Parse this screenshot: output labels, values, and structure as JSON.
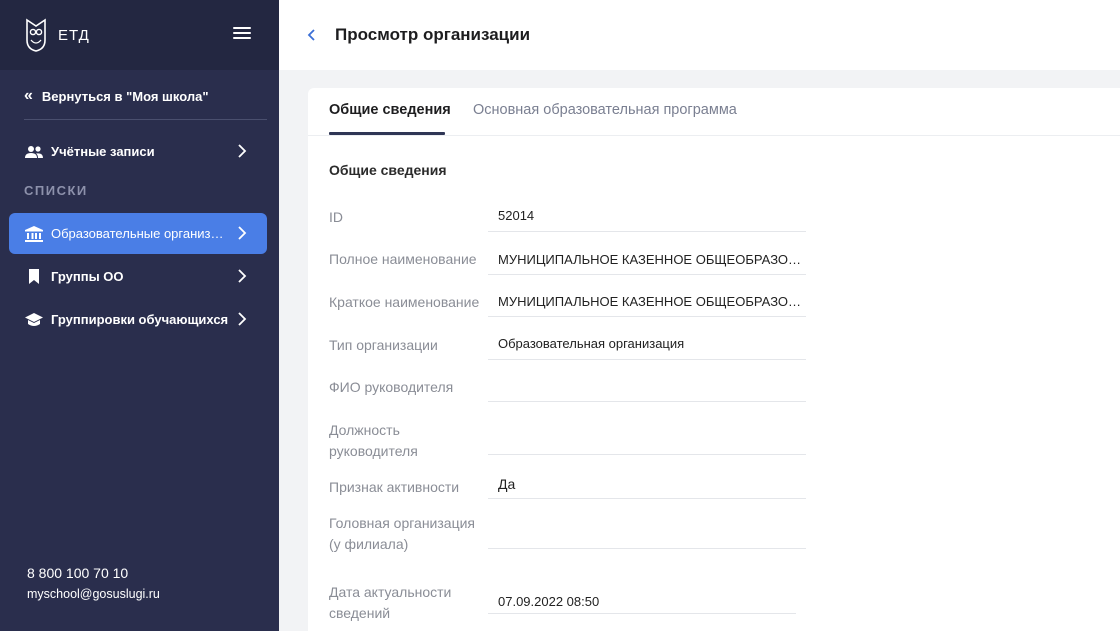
{
  "sidebar": {
    "logo_text": "ЕТД",
    "back_label": "Вернуться в \"Моя школа\"",
    "accounts_label": "Учётные записи",
    "section_title": "СПИСКИ",
    "items": [
      {
        "label": "Образовательные организации",
        "active": true
      },
      {
        "label": "Группы ОО"
      },
      {
        "label": "Группировки обучающихся"
      }
    ],
    "phone": "8 800 100 70 10",
    "email": "myschool@gosuslugi.ru"
  },
  "header": {
    "title": "Просмотр организации"
  },
  "tabs": [
    {
      "label": "Общие сведения",
      "active": true
    },
    {
      "label": "Основная образовательная программа"
    }
  ],
  "main": {
    "section_title": "Общие сведения",
    "fields": [
      {
        "label": "ID",
        "value": "52014"
      },
      {
        "label": "Полное наименование",
        "value": "МУНИЦИПАЛЬНОЕ КАЗЕННОЕ ОБЩЕОБРАЗОВАТЕЛЬНОЕ УЧРЕЖДЕНИЕ"
      },
      {
        "label": "Краткое наименование",
        "value": "МУНИЦИПАЛЬНОЕ КАЗЕННОЕ ОБЩЕОБРАЗОВАТЕЛЬНОЕ УЧРЕЖДЕНИЕ"
      },
      {
        "label": "Тип организации",
        "value": "Образовательная организация"
      },
      {
        "label": "ФИО руководителя",
        "value": ""
      },
      {
        "label": "Должность руководителя",
        "value": ""
      },
      {
        "label": "Признак активности",
        "value": "Да"
      },
      {
        "label": "Головная организация (у филиала)",
        "value": ""
      },
      {
        "label": "Дата актуальности сведений",
        "value": "07.09.2022 08:50"
      }
    ]
  },
  "colors": {
    "sidebar_bg": "#2a2e4d",
    "sidebar_top_bg": "#232741",
    "active_item": "#4a7ee6",
    "accent": "#3b6fd6"
  }
}
